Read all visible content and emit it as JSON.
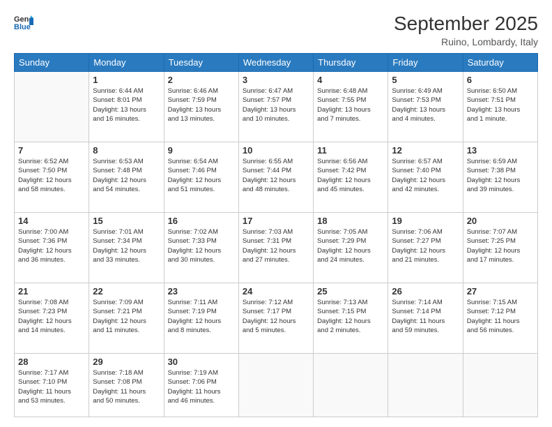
{
  "header": {
    "logo_general": "General",
    "logo_blue": "Blue",
    "title": "September 2025",
    "subtitle": "Ruino, Lombardy, Italy"
  },
  "days_of_week": [
    "Sunday",
    "Monday",
    "Tuesday",
    "Wednesday",
    "Thursday",
    "Friday",
    "Saturday"
  ],
  "weeks": [
    [
      {
        "day": "",
        "info": ""
      },
      {
        "day": "1",
        "info": "Sunrise: 6:44 AM\nSunset: 8:01 PM\nDaylight: 13 hours\nand 16 minutes."
      },
      {
        "day": "2",
        "info": "Sunrise: 6:46 AM\nSunset: 7:59 PM\nDaylight: 13 hours\nand 13 minutes."
      },
      {
        "day": "3",
        "info": "Sunrise: 6:47 AM\nSunset: 7:57 PM\nDaylight: 13 hours\nand 10 minutes."
      },
      {
        "day": "4",
        "info": "Sunrise: 6:48 AM\nSunset: 7:55 PM\nDaylight: 13 hours\nand 7 minutes."
      },
      {
        "day": "5",
        "info": "Sunrise: 6:49 AM\nSunset: 7:53 PM\nDaylight: 13 hours\nand 4 minutes."
      },
      {
        "day": "6",
        "info": "Sunrise: 6:50 AM\nSunset: 7:51 PM\nDaylight: 13 hours\nand 1 minute."
      }
    ],
    [
      {
        "day": "7",
        "info": "Sunrise: 6:52 AM\nSunset: 7:50 PM\nDaylight: 12 hours\nand 58 minutes."
      },
      {
        "day": "8",
        "info": "Sunrise: 6:53 AM\nSunset: 7:48 PM\nDaylight: 12 hours\nand 54 minutes."
      },
      {
        "day": "9",
        "info": "Sunrise: 6:54 AM\nSunset: 7:46 PM\nDaylight: 12 hours\nand 51 minutes."
      },
      {
        "day": "10",
        "info": "Sunrise: 6:55 AM\nSunset: 7:44 PM\nDaylight: 12 hours\nand 48 minutes."
      },
      {
        "day": "11",
        "info": "Sunrise: 6:56 AM\nSunset: 7:42 PM\nDaylight: 12 hours\nand 45 minutes."
      },
      {
        "day": "12",
        "info": "Sunrise: 6:57 AM\nSunset: 7:40 PM\nDaylight: 12 hours\nand 42 minutes."
      },
      {
        "day": "13",
        "info": "Sunrise: 6:59 AM\nSunset: 7:38 PM\nDaylight: 12 hours\nand 39 minutes."
      }
    ],
    [
      {
        "day": "14",
        "info": "Sunrise: 7:00 AM\nSunset: 7:36 PM\nDaylight: 12 hours\nand 36 minutes."
      },
      {
        "day": "15",
        "info": "Sunrise: 7:01 AM\nSunset: 7:34 PM\nDaylight: 12 hours\nand 33 minutes."
      },
      {
        "day": "16",
        "info": "Sunrise: 7:02 AM\nSunset: 7:33 PM\nDaylight: 12 hours\nand 30 minutes."
      },
      {
        "day": "17",
        "info": "Sunrise: 7:03 AM\nSunset: 7:31 PM\nDaylight: 12 hours\nand 27 minutes."
      },
      {
        "day": "18",
        "info": "Sunrise: 7:05 AM\nSunset: 7:29 PM\nDaylight: 12 hours\nand 24 minutes."
      },
      {
        "day": "19",
        "info": "Sunrise: 7:06 AM\nSunset: 7:27 PM\nDaylight: 12 hours\nand 21 minutes."
      },
      {
        "day": "20",
        "info": "Sunrise: 7:07 AM\nSunset: 7:25 PM\nDaylight: 12 hours\nand 17 minutes."
      }
    ],
    [
      {
        "day": "21",
        "info": "Sunrise: 7:08 AM\nSunset: 7:23 PM\nDaylight: 12 hours\nand 14 minutes."
      },
      {
        "day": "22",
        "info": "Sunrise: 7:09 AM\nSunset: 7:21 PM\nDaylight: 12 hours\nand 11 minutes."
      },
      {
        "day": "23",
        "info": "Sunrise: 7:11 AM\nSunset: 7:19 PM\nDaylight: 12 hours\nand 8 minutes."
      },
      {
        "day": "24",
        "info": "Sunrise: 7:12 AM\nSunset: 7:17 PM\nDaylight: 12 hours\nand 5 minutes."
      },
      {
        "day": "25",
        "info": "Sunrise: 7:13 AM\nSunset: 7:15 PM\nDaylight: 12 hours\nand 2 minutes."
      },
      {
        "day": "26",
        "info": "Sunrise: 7:14 AM\nSunset: 7:14 PM\nDaylight: 11 hours\nand 59 minutes."
      },
      {
        "day": "27",
        "info": "Sunrise: 7:15 AM\nSunset: 7:12 PM\nDaylight: 11 hours\nand 56 minutes."
      }
    ],
    [
      {
        "day": "28",
        "info": "Sunrise: 7:17 AM\nSunset: 7:10 PM\nDaylight: 11 hours\nand 53 minutes."
      },
      {
        "day": "29",
        "info": "Sunrise: 7:18 AM\nSunset: 7:08 PM\nDaylight: 11 hours\nand 50 minutes."
      },
      {
        "day": "30",
        "info": "Sunrise: 7:19 AM\nSunset: 7:06 PM\nDaylight: 11 hours\nand 46 minutes."
      },
      {
        "day": "",
        "info": ""
      },
      {
        "day": "",
        "info": ""
      },
      {
        "day": "",
        "info": ""
      },
      {
        "day": "",
        "info": ""
      }
    ]
  ]
}
